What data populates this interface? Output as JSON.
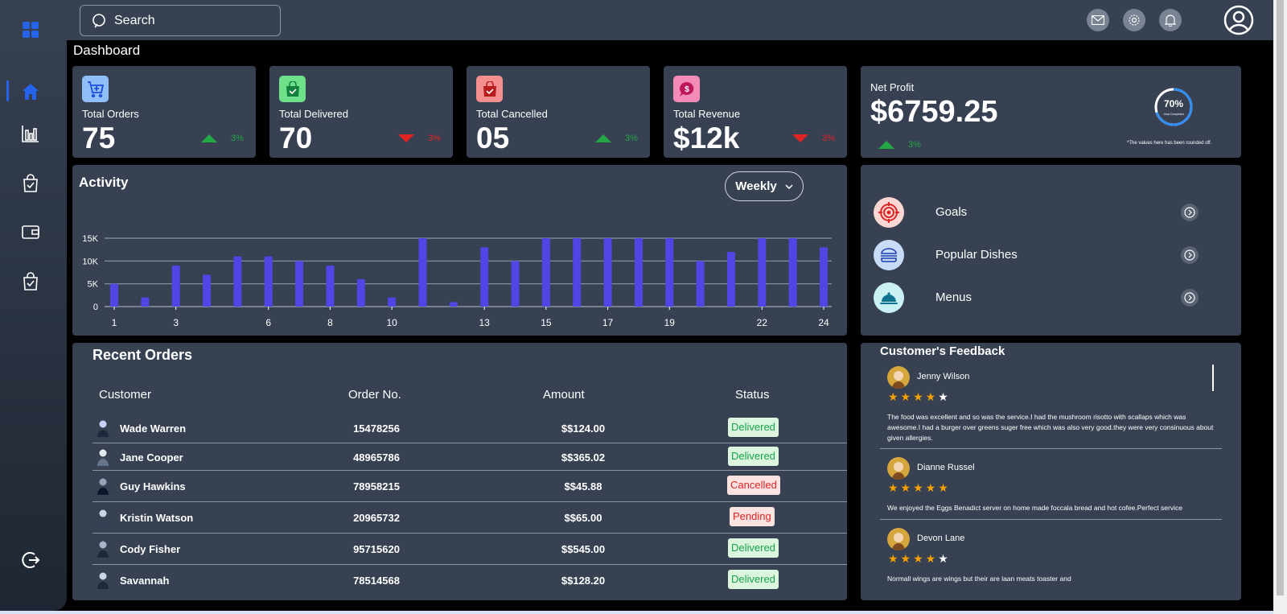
{
  "search": {
    "placeholder": "Search"
  },
  "page_title": "Dashboard",
  "stats": [
    {
      "label": "Total Orders",
      "value": "75",
      "pct": "3%",
      "trend": "up",
      "icon": "cart-plus-icon",
      "icon_bg": "#8fbef8"
    },
    {
      "label": "Total Delivered",
      "value": "70",
      "pct": "3%",
      "trend": "down",
      "icon": "bag-check-icon",
      "icon_bg": "#6ee089"
    },
    {
      "label": "Total Cancelled",
      "value": "05",
      "pct": "3%",
      "trend": "up",
      "icon": "bag-x-icon",
      "icon_bg": "#f48f8f"
    },
    {
      "label": "Total Revenue",
      "value": "$12k",
      "pct": "3%",
      "trend": "down",
      "icon": "dollar-chat-icon",
      "icon_bg": "#f58cb8"
    }
  ],
  "net_profit": {
    "label": "Net Profit",
    "value": "$6759.25",
    "pct": "3%",
    "goal_percent": "70%",
    "goal_label": "Goal Completed",
    "note": "*The values here has been rounded off."
  },
  "activity": {
    "title": "Activity",
    "period": "Weekly"
  },
  "chart_data": {
    "type": "bar",
    "x": [
      1,
      2,
      3,
      4,
      5,
      6,
      7,
      8,
      9,
      10,
      11,
      12,
      13,
      14,
      15,
      16,
      17,
      18,
      19,
      20,
      21,
      22,
      23,
      24
    ],
    "xticks": [
      "1",
      "3",
      "6",
      "8",
      "10",
      "13",
      "15",
      "17",
      "19",
      "22",
      "24"
    ],
    "values": [
      5000,
      2000,
      9000,
      7000,
      11000,
      11000,
      10000,
      9000,
      6000,
      2000,
      15000,
      1000,
      13000,
      10000,
      15000,
      15000,
      15000,
      15000,
      15000,
      10000,
      12000,
      15000,
      15000,
      13000
    ],
    "yticks": [
      "0",
      "5K",
      "10K",
      "15K"
    ],
    "ylim": [
      0,
      15000
    ],
    "color": "#5046e5",
    "grid": true
  },
  "quick_links": [
    {
      "label": "Goals",
      "icon": "target-icon",
      "bg": "#fbd7d4"
    },
    {
      "label": "Popular Dishes",
      "icon": "burger-icon",
      "bg": "#c9dcf7"
    },
    {
      "label": "Menus",
      "icon": "cloche-icon",
      "bg": "#c9f1f3"
    }
  ],
  "recent_orders": {
    "title": "Recent Orders",
    "headers": {
      "customer": "Customer",
      "order_no": "Order No.",
      "amount": "Amount",
      "status": "Status"
    },
    "rows": [
      {
        "customer": "Wade Warren",
        "order_no": "15478256",
        "amount": "$$124.00",
        "status": "Delivered"
      },
      {
        "customer": "Jane Cooper",
        "order_no": "48965786",
        "amount": "$$365.02",
        "status": "Delivered"
      },
      {
        "customer": "Guy Hawkins",
        "order_no": "78958215",
        "amount": "$$45.88",
        "status": "Cancelled"
      },
      {
        "customer": "Kristin Watson",
        "order_no": "20965732",
        "amount": "$$65.00",
        "status": "Pending"
      },
      {
        "customer": "Cody Fisher",
        "order_no": "95715620",
        "amount": "$$545.00",
        "status": "Delivered"
      },
      {
        "customer": "Savannah",
        "order_no": "78514568",
        "amount": "$$128.20",
        "status": "Delivered"
      }
    ]
  },
  "feedback": {
    "title": "Customer's Feedback",
    "items": [
      {
        "name": "Jenny Wilson",
        "rating": 4,
        "text": "The food was excellent and so was the service.I had the mushroom risotto with scallaps which was awesome.I had a burger over greens suger free which was also very good.they were very consinuous about given allergies."
      },
      {
        "name": "Dianne Russel",
        "rating": 5,
        "text": "We enjoyed the Eggs Benadict server on home made foccala bread and hot cofee.Perfect service"
      },
      {
        "name": "Devon Lane",
        "rating": 4,
        "text": "Normall wings are wings but their are laan meats toaster and"
      }
    ]
  },
  "colors": {
    "accent": "#2563eb",
    "card_bg": "#374152",
    "bar": "#5046e5",
    "up": "#22a845",
    "down": "#e02424"
  }
}
